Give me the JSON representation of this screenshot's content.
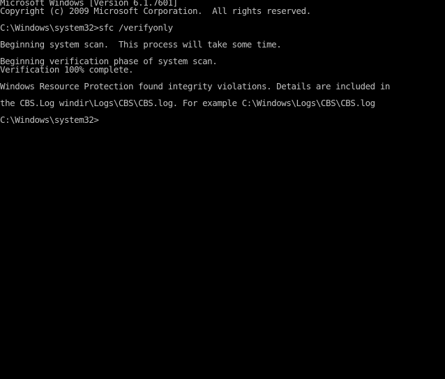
{
  "window": {
    "kind": "windows-command-prompt",
    "background_color": "#000000",
    "foreground_color": "#c0c0c0",
    "columns": 85,
    "rows": 45
  },
  "console": {
    "lines": [
      "Microsoft Windows [Version 6.1.7601]",
      "Copyright (c) 2009 Microsoft Corporation.  All rights reserved.",
      "",
      "C:\\Windows\\system32>sfc /verifyonly",
      "",
      "Beginning system scan.  This process will take some time.",
      "",
      "Beginning verification phase of system scan.",
      "Verification 100% complete.",
      "",
      "Windows Resource Protection found integrity violations. Details are included in",
      "",
      "the CBS.Log windir\\Logs\\CBS\\CBS.log. For example C:\\Windows\\Logs\\CBS\\CBS.log",
      "",
      "C:\\Windows\\system32>"
    ],
    "os_name": "Microsoft Windows",
    "os_version": "[Version 6.1.7601]",
    "copyright": "Copyright (c) 2009 Microsoft Corporation.  All rights reserved.",
    "command": "sfc /verifyonly",
    "prompt": "C:\\Windows\\system32>",
    "scan_start_message": "Beginning system scan.  This process will take some time.",
    "verification_phase_message": "Beginning verification phase of system scan.",
    "verification_progress": "Verification 100% complete.",
    "result_message_line1": "Windows Resource Protection found integrity violations. Details are included in",
    "result_message_line2": "the CBS.Log windir\\Logs\\CBS\\CBS.log. For example C:\\Windows\\Logs\\CBS\\CBS.log",
    "log_path": "C:\\Windows\\Logs\\CBS\\CBS.log",
    "progress_percent": "100%"
  }
}
